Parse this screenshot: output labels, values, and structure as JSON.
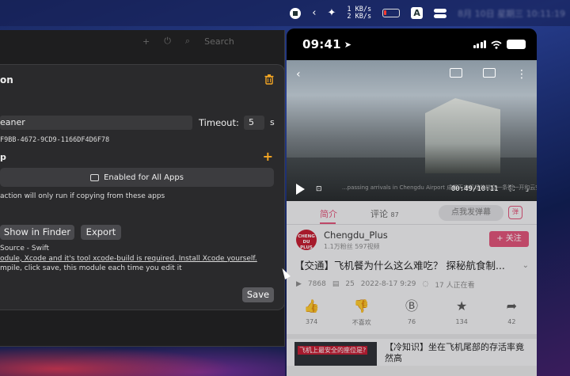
{
  "menubar": {
    "net_up": "1 KB/s",
    "net_down": "2 KB/s",
    "keyboard": "A",
    "clock_blurred": "8月 10日 星期三 10:11:19"
  },
  "window": {
    "toolbar_search": "Search",
    "panel": {
      "title": "on",
      "name_value": "eaner",
      "timeout_label": "Timeout:",
      "timeout_value": "5",
      "timeout_unit": "s",
      "uuid": "F9BB-4672-9CD9-1166DF4D6F78",
      "section_label": "p",
      "apps_button": "Enabled for All Apps",
      "apps_hint": "action will only run if copying from these apps",
      "show_in_finder": "Show in Finder",
      "export": "Export",
      "source_line1": "Source - Swift",
      "source_line2": "odule, Xcode and it's tool xcode-build is required. Install Xcode yourself.",
      "source_line3": "mpile, click save, this module each time you edit it",
      "save": "Save"
    }
  },
  "phone": {
    "time": "09:41",
    "video_time": "00:49/10:11",
    "video_sub": "...passing arrivals in Chengdu Airport 成都天府机场的航空一条街一开和云空...",
    "tabs": {
      "intro": "简介",
      "comments": "评论",
      "comment_count": "87",
      "danmaku": "点我发弹幕",
      "dm_icon": "弹"
    },
    "uploader": {
      "avatar_text": "CHENG DU PLUS",
      "name": "Chengdu_Plus",
      "stats": "1.1万粉丝  597视频",
      "follow": "+ 关注"
    },
    "video_title": "【交通】飞机餐为什么这么难吃？ 探秘航食制...",
    "meta": {
      "views": "7868",
      "danmaku_count": "25",
      "date": "2022-8-17 9:29",
      "watching": "17 人正在看"
    },
    "actions": [
      {
        "icon": "👍",
        "label": "374"
      },
      {
        "icon": "👎",
        "label": "不喜欢"
      },
      {
        "icon": "Ⓑ",
        "label": "76"
      },
      {
        "icon": "★",
        "label": "134"
      },
      {
        "icon": "➦",
        "label": "42"
      }
    ],
    "recommend": {
      "thumb_text": "飞机上最安全的座位是?",
      "title": "【冷知识】坐在飞机尾部的存活率竟然高"
    }
  }
}
